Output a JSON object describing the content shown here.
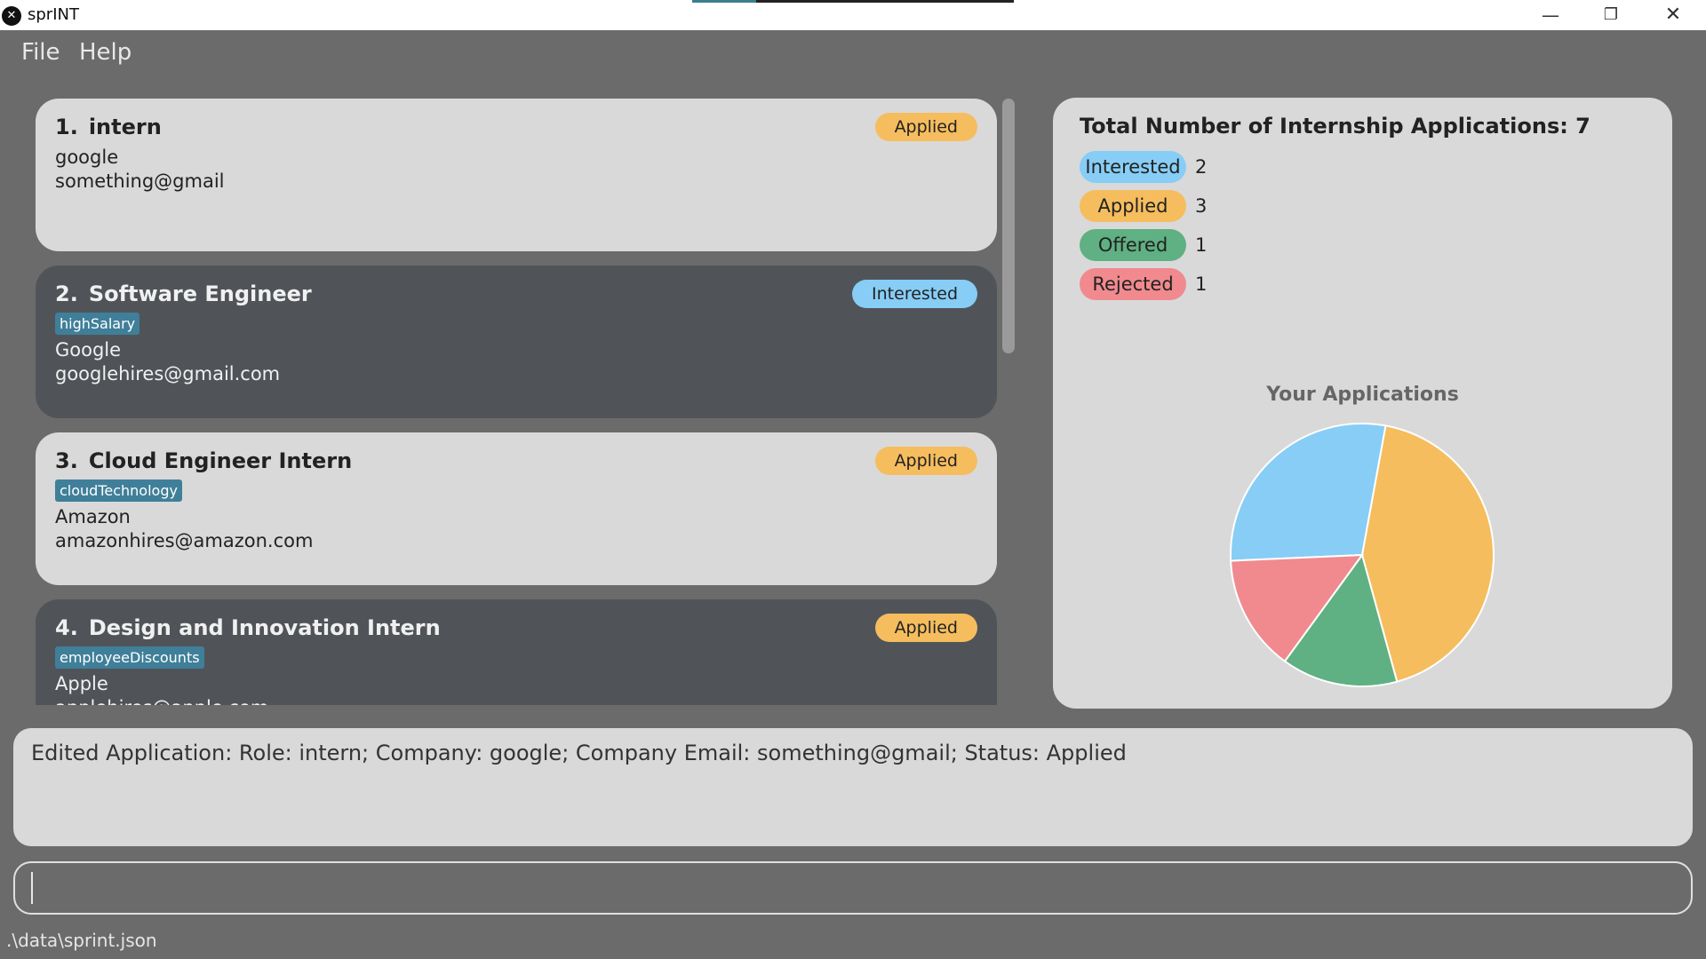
{
  "window": {
    "title": "sprINT",
    "logo_glyph": "✕"
  },
  "window_controls": {
    "minimize": "—",
    "maximize": "❐",
    "close": "✕"
  },
  "loading_progress": 0.2,
  "menu": {
    "file": "File",
    "help": "Help"
  },
  "applications": [
    {
      "index": "1.",
      "role": "intern",
      "tag": "",
      "company": "google",
      "email": "something@gmail",
      "status": "Applied"
    },
    {
      "index": "2.",
      "role": "Software Engineer",
      "tag": "highSalary",
      "company": "Google",
      "email": "googlehires@gmail.com",
      "status": "Interested"
    },
    {
      "index": "3.",
      "role": "Cloud Engineer Intern",
      "tag": "cloudTechnology",
      "company": "Amazon",
      "email": "amazonhires@amazon.com",
      "status": "Applied"
    },
    {
      "index": "4.",
      "role": "Design and Innovation Intern",
      "tag": "employeeDiscounts",
      "company": "Apple",
      "email": "applehires@apple.com",
      "status": "Applied"
    }
  ],
  "status_colors": {
    "Interested": "#87cdf5",
    "Applied": "#f5bd5e",
    "Offered": "#5fb082",
    "Rejected": "#f08a8e"
  },
  "stats": {
    "title": "Total Number of Internship Applications: 7",
    "legend": [
      {
        "label": "Interested",
        "count": "2"
      },
      {
        "label": "Applied",
        "count": "3"
      },
      {
        "label": "Offered",
        "count": "1"
      },
      {
        "label": "Rejected",
        "count": "1"
      }
    ]
  },
  "chart_data": {
    "type": "pie",
    "title": "Your Applications",
    "categories": [
      "Interested",
      "Applied",
      "Offered",
      "Rejected"
    ],
    "values": [
      2,
      3,
      1,
      1
    ],
    "colors": [
      "#87cdf5",
      "#f5bd5e",
      "#5fb082",
      "#f08a8e"
    ]
  },
  "result": {
    "text": "Edited Application: Role: intern; Company: google; Company Email: something@gmail; Status: Applied"
  },
  "command": {
    "value": ""
  },
  "status_bar": {
    "path": ".\\data\\sprint.json"
  }
}
